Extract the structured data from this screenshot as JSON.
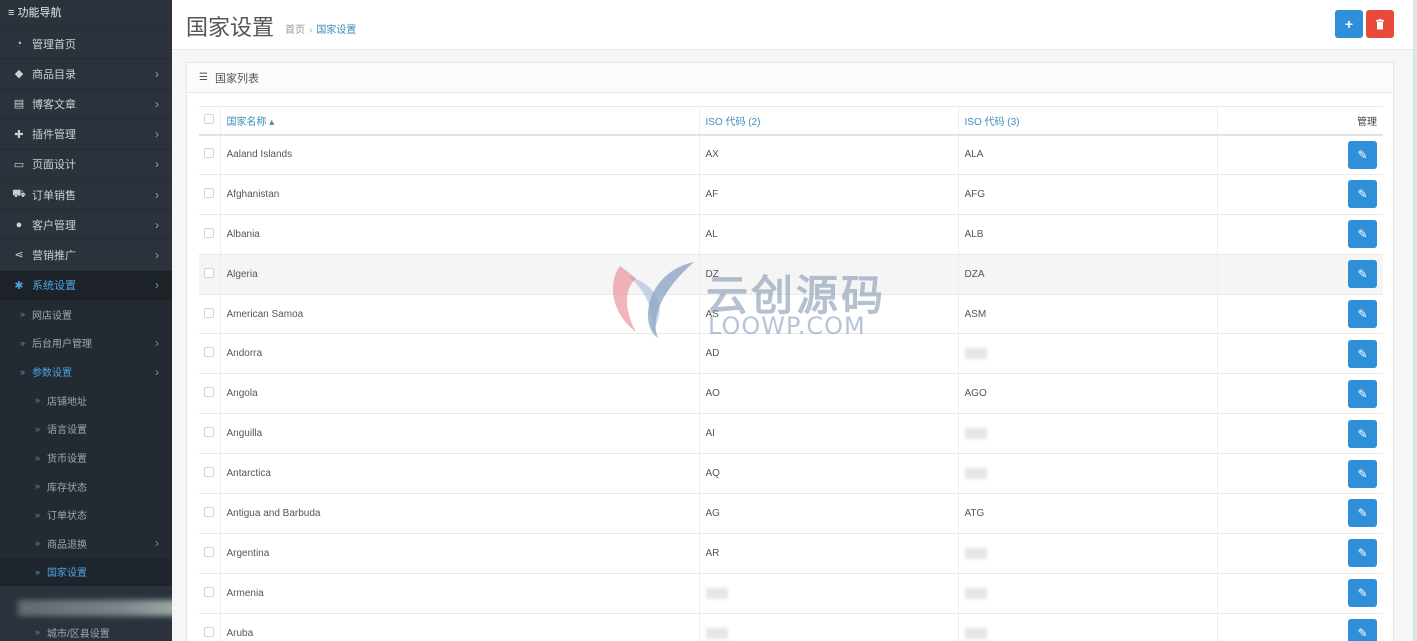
{
  "sidebar": {
    "title": "≡ 功能导航",
    "items": [
      {
        "label": "管理首页",
        "icon": "dashboard-icon",
        "has_children": false
      },
      {
        "label": "商品目录",
        "icon": "tag-icon",
        "has_children": true
      },
      {
        "label": "博客文章",
        "icon": "newspaper-icon",
        "has_children": true
      },
      {
        "label": "插件管理",
        "icon": "puzzle-icon",
        "has_children": true
      },
      {
        "label": "页面设计",
        "icon": "desktop-icon",
        "has_children": true
      },
      {
        "label": "订单销售",
        "icon": "cart-icon",
        "has_children": true
      },
      {
        "label": "客户管理",
        "icon": "user-icon",
        "has_children": true
      },
      {
        "label": "营销推广",
        "icon": "share-icon",
        "has_children": true
      },
      {
        "label": "系统设置",
        "icon": "gear-icon",
        "has_children": true,
        "active": true
      }
    ],
    "system_sub": [
      {
        "label": "网店设置"
      },
      {
        "label": "后台用户管理",
        "has_children": true
      },
      {
        "label": "参数设置",
        "has_children": true,
        "open": true
      }
    ],
    "param_sub": [
      {
        "label": "店铺地址"
      },
      {
        "label": "语言设置"
      },
      {
        "label": "货币设置"
      },
      {
        "label": "库存状态"
      },
      {
        "label": "订单状态"
      },
      {
        "label": "商品退换",
        "has_children": true
      },
      {
        "label": "国家设置",
        "current": true
      }
    ],
    "after_blur": "城市/区县设置"
  },
  "header": {
    "title": "国家设置",
    "breadcrumb_home": "首页",
    "breadcrumb_sep": "›",
    "breadcrumb_current": "国家设置",
    "add_icon": "+",
    "delete_icon": "trash-icon"
  },
  "panel": {
    "title": "国家列表"
  },
  "table": {
    "headers": {
      "name": "国家名称 ▴",
      "iso2": "ISO 代码 (2)",
      "iso3": "ISO 代码 (3)",
      "manage": "管理"
    },
    "rows": [
      {
        "name": "Aaland Islands",
        "iso2": "AX",
        "iso3": "ALA"
      },
      {
        "name": "Afghanistan",
        "iso2": "AF",
        "iso3": "AFG"
      },
      {
        "name": "Albania",
        "iso2": "AL",
        "iso3": "ALB"
      },
      {
        "name": "Algeria",
        "iso2": "DZ",
        "iso3": "DZA",
        "highlight": true
      },
      {
        "name": "American Samoa",
        "iso2": "AS",
        "iso3": "ASM"
      },
      {
        "name": "Andorra",
        "iso2": "AD",
        "iso3": ""
      },
      {
        "name": "Angola",
        "iso2": "AO",
        "iso3": "AGO"
      },
      {
        "name": "Anguilla",
        "iso2": "AI",
        "iso3": ""
      },
      {
        "name": "Antarctica",
        "iso2": "AQ",
        "iso3": ""
      },
      {
        "name": "Antigua and Barbuda",
        "iso2": "AG",
        "iso3": "ATG"
      },
      {
        "name": "Argentina",
        "iso2": "AR",
        "iso3": ""
      },
      {
        "name": "Armenia",
        "iso2": "",
        "iso3": ""
      },
      {
        "name": "Aruba",
        "iso2": "",
        "iso3": ""
      }
    ]
  },
  "watermark": {
    "line1": "云创源码",
    "line2": "LOOWP.COM"
  },
  "colors": {
    "sidebar_bg": "#2b323b",
    "accent_blue": "#2f8fd8",
    "link_blue": "#3c8dbc",
    "danger_red": "#e84a3b"
  }
}
